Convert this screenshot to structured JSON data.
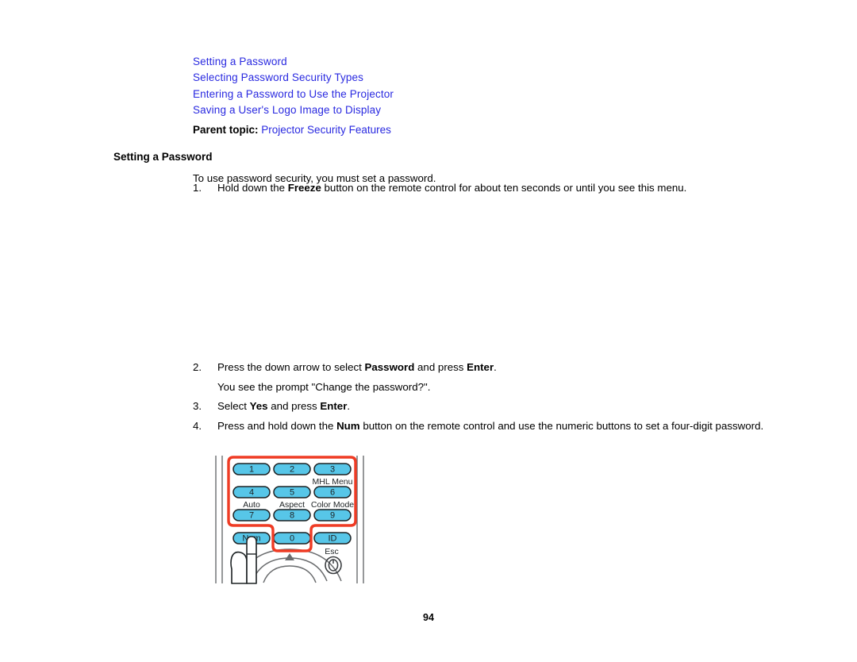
{
  "document": {
    "page_number": "94",
    "link_color": "#2929e0",
    "text_color": "#000000",
    "background": "#ffffff"
  },
  "toc": {
    "links": [
      {
        "label": "Setting a Password"
      },
      {
        "label": "Selecting Password Security Types"
      },
      {
        "label": "Entering a Password to Use the Projector"
      },
      {
        "label": "Saving a User's Logo Image to Display"
      }
    ]
  },
  "parent_topic": {
    "label": "Parent topic:",
    "link": "Projector Security Features"
  },
  "section": {
    "heading": "Setting a Password",
    "intro": "To use password security, you must set a password."
  },
  "steps": [
    {
      "number": "1.",
      "parts": [
        {
          "text": "Hold down the ",
          "bold": false
        },
        {
          "text": "Freeze",
          "bold": true
        },
        {
          "text": " button on the remote control for about ten seconds or until you see this menu.",
          "bold": false
        }
      ]
    },
    {
      "number": "2.",
      "parts": [
        {
          "text": "Press the down arrow to select ",
          "bold": false
        },
        {
          "text": "Password",
          "bold": true
        },
        {
          "text": " and press ",
          "bold": false
        },
        {
          "text": "Enter",
          "bold": true
        },
        {
          "text": ".",
          "bold": false
        }
      ]
    },
    {
      "number": "3.",
      "parts": [
        {
          "text": "Select ",
          "bold": false
        },
        {
          "text": "Yes",
          "bold": true
        },
        {
          "text": " and press ",
          "bold": false
        },
        {
          "text": "Enter",
          "bold": true
        },
        {
          "text": ".",
          "bold": false
        }
      ]
    },
    {
      "number": "4.",
      "parts": [
        {
          "text": "Press and hold down the ",
          "bold": false
        },
        {
          "text": "Num",
          "bold": true
        },
        {
          "text": " button on the remote control and use the numeric buttons to set a four-digit password.",
          "bold": false
        }
      ]
    }
  ],
  "prompt_note": "You see the prompt \"Change the password?\".",
  "remote_figure": {
    "alt": "Epson projector remote control numeric keypad with Num button highlighted",
    "button_fill": "#57c6e8",
    "button_stroke": "#1d2224",
    "highlight_color": "#ef3b24",
    "body_stroke": "#58595b",
    "keys": [
      {
        "label": "1"
      },
      {
        "label": "2"
      },
      {
        "label": "3"
      },
      {
        "label": "4"
      },
      {
        "label": "5"
      },
      {
        "label": "6"
      },
      {
        "label": "7"
      },
      {
        "label": "8"
      },
      {
        "label": "9"
      },
      {
        "label": "Num"
      },
      {
        "label": "0"
      },
      {
        "label": "ID"
      }
    ],
    "captions": [
      {
        "label": "MHL Menu"
      },
      {
        "label": "Auto"
      },
      {
        "label": "Aspect"
      },
      {
        "label": "Color Mode"
      },
      {
        "label": "Esc"
      }
    ]
  }
}
